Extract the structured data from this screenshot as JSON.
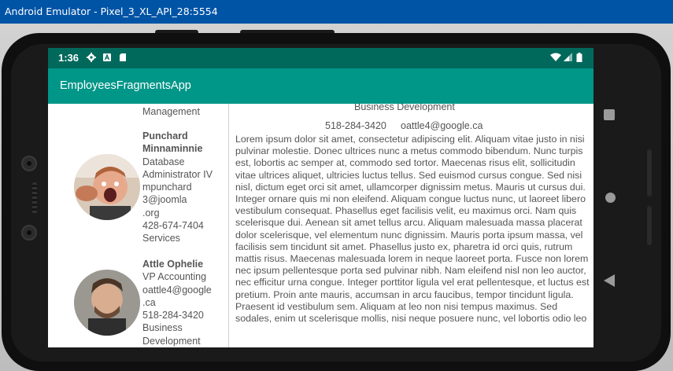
{
  "window": {
    "title": "Android Emulator - Pixel_3_XL_API_28:5554"
  },
  "status_bar": {
    "time": "1:36"
  },
  "app_bar": {
    "title": "EmployeesFragmentsApp"
  },
  "employees": [
    {
      "name": "",
      "lines": [
        "Management"
      ]
    },
    {
      "name": "Punchard Minnaminnie",
      "lines": [
        "Database",
        "Administrator IV",
        "mpunchard",
        "3@joomla",
        ".org",
        "428-674-7404",
        "Services"
      ]
    },
    {
      "name": "Attle Ophelie",
      "lines": [
        "VP Accounting",
        "oattle4@google",
        ".ca",
        "518-284-3420",
        "Business",
        "Development"
      ]
    }
  ],
  "detail": {
    "department": "Business Development",
    "phone": "518-284-3420",
    "email": "oattle4@google.ca",
    "body": "Lorem ipsum dolor sit amet, consectetur adipiscing elit. Aliquam vitae justo in nisi pulvinar molestie. Donec ultrices nunc a metus commodo bibendum. Nunc turpis est, lobortis ac semper at, commodo sed tortor. Maecenas risus elit, sollicitudin vitae ultrices aliquet, ultricies luctus tellus. Sed euismod cursus congue. Sed nisi nisl, dictum eget orci sit amet, ullamcorper dignissim metus. Mauris ut cursus dui. Integer ornare quis mi non eleifend. Aliquam congue luctus nunc, ut laoreet libero vestibulum consequat. Phasellus eget facilisis velit, eu maximus orci. Nam quis scelerisque dui. Aenean sit amet tellus arcu. Aliquam malesuada massa placerat dolor scelerisque, vel elementum nunc dignissim. Mauris porta ipsum massa, vel facilisis sem tincidunt sit amet. Phasellus justo ex, pharetra id orci quis, rutrum mattis risus. Maecenas malesuada lorem in neque laoreet porta. Fusce non lorem nec ipsum pellentesque porta sed pulvinar nibh. Nam eleifend nisl non leo auctor, nec efficitur urna congue. Integer porttitor ligula vel erat pellentesque, et luctus est pretium. Proin ante mauris, accumsan in arcu faucibus, tempor tincidunt ligula. Praesent id vestibulum sem. Aliquam at leo non nisi tempus maximus. Sed sodales, enim ut scelerisque mollis, nisi neque posuere nunc, vel lobortis odio leo"
  },
  "icons": {
    "status_left": [
      "gear-icon",
      "a-notification-icon",
      "sd-card-icon"
    ],
    "status_right": [
      "wifi-icon",
      "signal-icon",
      "battery-icon"
    ],
    "nav": [
      "square-recents-icon",
      "circle-home-icon",
      "triangle-back-icon"
    ]
  },
  "colors": {
    "status_bar": "#00695c",
    "app_bar": "#009688",
    "window_titlebar": "#0054a6"
  }
}
